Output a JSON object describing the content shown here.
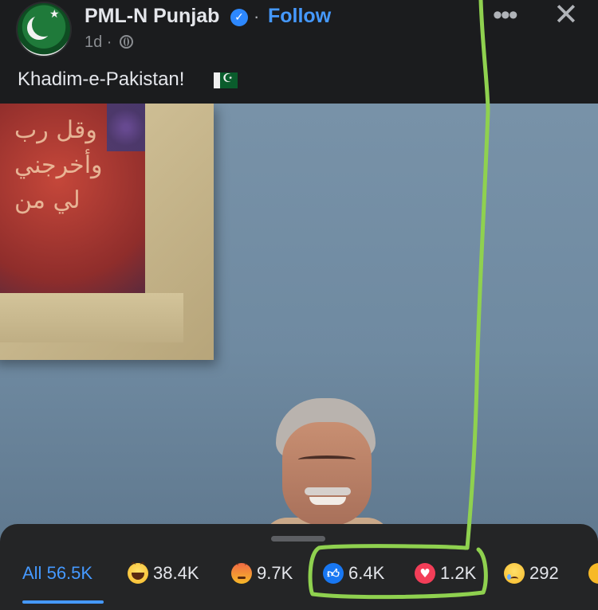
{
  "header": {
    "page_name": "PML-N Punjab",
    "verified_icon": "verified-badge-icon",
    "separator": "·",
    "follow_label": "Follow",
    "time": "1d ·",
    "audience_icon": "globe-icon",
    "more_icon": "more-options-icon",
    "close_icon": "close-icon",
    "avatar_icon": "pml-n-logo"
  },
  "post": {
    "caption": "Khadim-e-Pakistan!",
    "caption_emoji": "pakistan-flag-icon",
    "photo_icon": "post-photo"
  },
  "reactions": {
    "tabs": [
      {
        "label": "All",
        "count": "56.5K",
        "icon": null,
        "active": true
      },
      {
        "label": "",
        "count": "38.4K",
        "icon": "haha-icon",
        "active": false
      },
      {
        "label": "",
        "count": "9.7K",
        "icon": "angry-icon",
        "active": false
      },
      {
        "label": "",
        "count": "6.4K",
        "icon": "like-icon",
        "active": false
      },
      {
        "label": "",
        "count": "1.2K",
        "icon": "love-icon",
        "active": false
      },
      {
        "label": "",
        "count": "292",
        "icon": "sad-icon",
        "active": false
      }
    ]
  },
  "colors": {
    "accent_blue": "#4599ff",
    "annotation_green": "#8fd14f",
    "background": "#18191a"
  }
}
